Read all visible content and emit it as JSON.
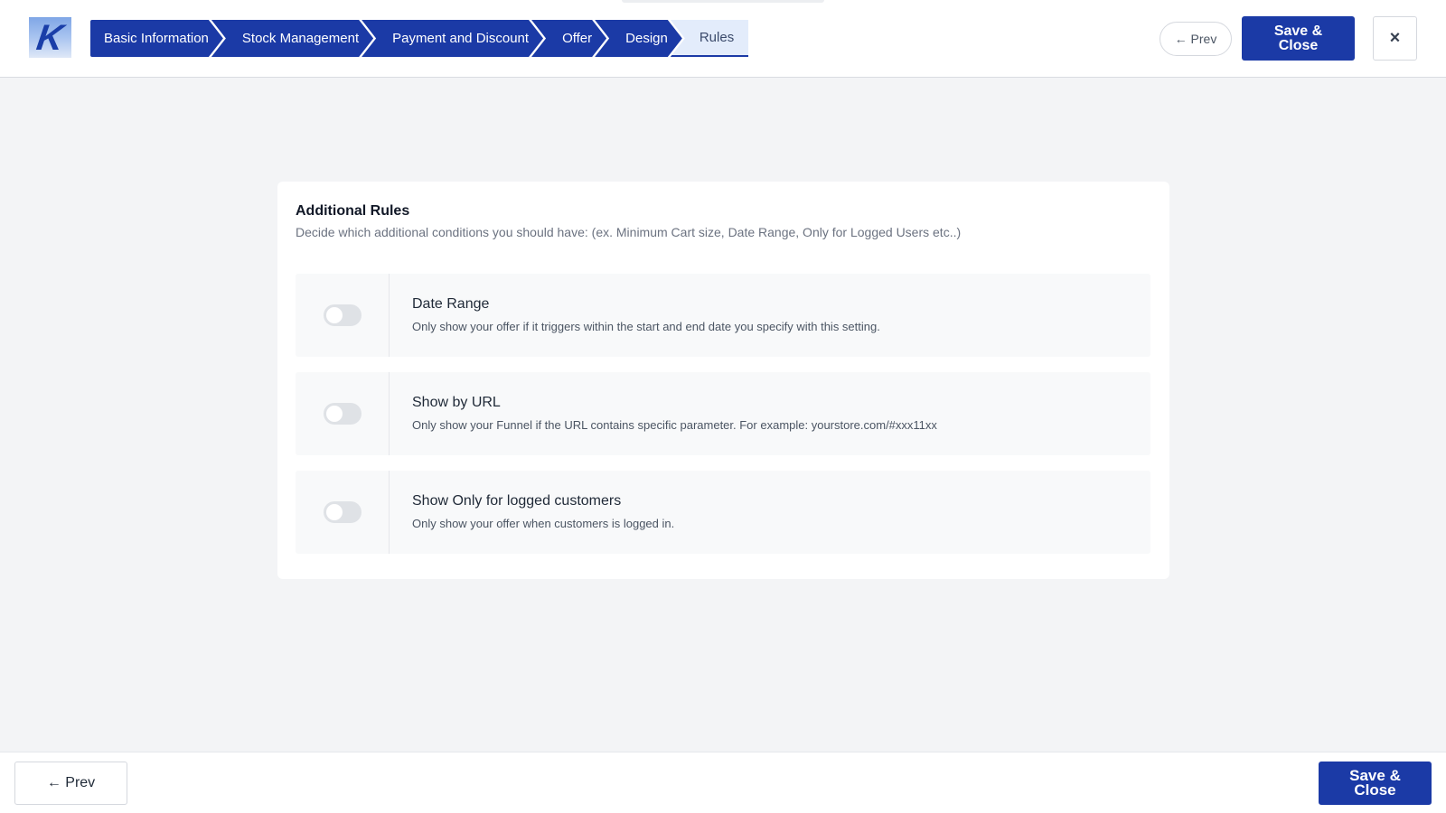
{
  "header": {
    "logo_letter": "K",
    "steps": [
      {
        "label": "Basic Information",
        "state": "completed"
      },
      {
        "label": "Stock Management",
        "state": "completed"
      },
      {
        "label": "Payment and Discount",
        "state": "completed"
      },
      {
        "label": "Offer",
        "state": "completed"
      },
      {
        "label": "Design",
        "state": "completed"
      },
      {
        "label": "Rules",
        "state": "active"
      }
    ],
    "prev_label": "← Prev",
    "save_label_line1": "Save &",
    "save_label_line2": "Close",
    "close_icon": "×"
  },
  "card": {
    "title": "Additional Rules",
    "subtitle": "Decide which additional conditions you should have: (ex. Minimum Cart size, Date Range, Only for Logged Users etc..)",
    "rules": [
      {
        "title": "Date Range",
        "description": "Only show your offer if it triggers within the start and end date you specify with this setting.",
        "enabled": false
      },
      {
        "title": "Show by URL",
        "description": "Only show your Funnel if the URL contains specific parameter. For example: yourstore.com/#xxx11xx",
        "enabled": false
      },
      {
        "title": "Show Only for logged customers",
        "description": "Only show your offer when customers is logged in.",
        "enabled": false
      }
    ]
  },
  "footer": {
    "prev_label": "← Prev",
    "save_label_line1": "Save &",
    "save_label_line2": "Close"
  },
  "colors": {
    "primary": "#1b3aa6",
    "active_step_bg": "#e3ecfb",
    "page_bg": "#f3f4f6",
    "toggle_off": "#dfe2e6"
  }
}
